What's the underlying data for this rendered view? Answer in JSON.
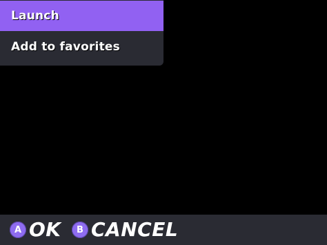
{
  "menu": {
    "items": [
      {
        "label": "Launch",
        "selected": true
      },
      {
        "label": "Add to favorites",
        "selected": false
      }
    ]
  },
  "bottom_bar": {
    "ok": {
      "button": "A",
      "label": "OK"
    },
    "cancel": {
      "button": "B",
      "label": "CANCEL"
    }
  },
  "colors": {
    "background": "#000000",
    "panel": "#2a2b33",
    "accent": "#9161f2",
    "button_circle": "#8e6cf0"
  }
}
